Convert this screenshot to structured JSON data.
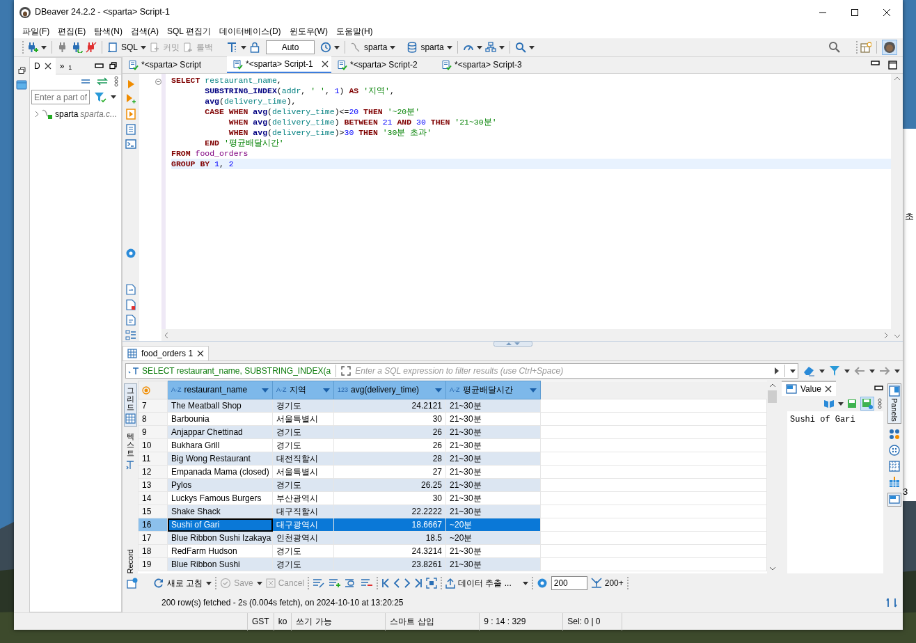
{
  "window": {
    "title": "DBeaver 24.2.2 - <sparta> Script-1"
  },
  "menu": [
    "파일(F)",
    "편집(E)",
    "탐색(N)",
    "검색(A)",
    "SQL 편집기",
    "데이터베이스(D)",
    "윈도우(W)",
    "도움말(H)"
  ],
  "toolbar": {
    "sql": "SQL",
    "commit": {
      "label": "커밋",
      "disabled": true
    },
    "rollback": {
      "label": "롤백",
      "disabled": true
    },
    "transaction_mode": "Auto",
    "datasource": "sparta",
    "schema": "sparta"
  },
  "navigator": {
    "tabs": [
      {
        "label": "D",
        "selected": true
      },
      {
        "label": "»$_{1}$",
        "selected": false
      }
    ],
    "filter": {
      "placeholder": "Enter a part of"
    },
    "tree": [
      {
        "label": "sparta",
        "detail": "sparta.c...",
        "expanded": false
      }
    ]
  },
  "editor_tabs": [
    {
      "label": "*<sparta> Script",
      "selected": false
    },
    {
      "label": "*<sparta> Script-1",
      "selected": true
    },
    {
      "label": "*<sparta> Script-2",
      "selected": false
    },
    {
      "label": "*<sparta> Script-3",
      "selected": false
    }
  ],
  "code": [
    {
      "current": false,
      "tokens": [
        {
          "text": "SELECT ",
          "kind": "keyword"
        },
        {
          "text": "restaurant_name",
          "kind": "column"
        },
        {
          "text": ",",
          "kind": "plain"
        }
      ]
    },
    {
      "current": false,
      "tokens": [
        {
          "text": "       SUBSTRING_INDEX",
          "kind": "function"
        },
        {
          "text": "(",
          "kind": "plain"
        },
        {
          "text": "addr",
          "kind": "column"
        },
        {
          "text": ", ",
          "kind": "plain"
        },
        {
          "text": "' '",
          "kind": "string"
        },
        {
          "text": ", ",
          "kind": "plain"
        },
        {
          "text": "1",
          "kind": "number"
        },
        {
          "text": ") ",
          "kind": "plain"
        },
        {
          "text": "AS ",
          "kind": "keyword"
        },
        {
          "text": "'지역'",
          "kind": "string"
        },
        {
          "text": ",",
          "kind": "plain"
        }
      ]
    },
    {
      "current": false,
      "tokens": [
        {
          "text": "       avg",
          "kind": "function"
        },
        {
          "text": "(",
          "kind": "plain"
        },
        {
          "text": "delivery_time",
          "kind": "column"
        },
        {
          "text": "),",
          "kind": "plain"
        }
      ]
    },
    {
      "current": false,
      "tokens": [
        {
          "text": "       CASE WHEN ",
          "kind": "keyword"
        },
        {
          "text": "avg",
          "kind": "function"
        },
        {
          "text": "(",
          "kind": "plain"
        },
        {
          "text": "delivery_time",
          "kind": "column"
        },
        {
          "text": ")<=",
          "kind": "plain"
        },
        {
          "text": "20",
          "kind": "number"
        },
        {
          "text": " THEN ",
          "kind": "keyword"
        },
        {
          "text": "'~20분'",
          "kind": "string"
        }
      ]
    },
    {
      "current": false,
      "tokens": [
        {
          "text": "            WHEN ",
          "kind": "keyword"
        },
        {
          "text": "avg",
          "kind": "function"
        },
        {
          "text": "(",
          "kind": "plain"
        },
        {
          "text": "delivery_time",
          "kind": "column"
        },
        {
          "text": ") ",
          "kind": "plain"
        },
        {
          "text": "BETWEEN ",
          "kind": "keyword"
        },
        {
          "text": "21",
          "kind": "number"
        },
        {
          "text": " AND ",
          "kind": "keyword"
        },
        {
          "text": "30",
          "kind": "number"
        },
        {
          "text": " THEN ",
          "kind": "keyword"
        },
        {
          "text": "'21~30분'",
          "kind": "string"
        }
      ]
    },
    {
      "current": false,
      "tokens": [
        {
          "text": "            WHEN ",
          "kind": "keyword"
        },
        {
          "text": "avg",
          "kind": "function"
        },
        {
          "text": "(",
          "kind": "plain"
        },
        {
          "text": "delivery_time",
          "kind": "column"
        },
        {
          "text": ")>",
          "kind": "plain"
        },
        {
          "text": "30",
          "kind": "number"
        },
        {
          "text": " THEN ",
          "kind": "keyword"
        },
        {
          "text": "'30분 초과'",
          "kind": "string"
        }
      ]
    },
    {
      "current": false,
      "tokens": [
        {
          "text": "       END ",
          "kind": "keyword"
        },
        {
          "text": "'평균배달시간'",
          "kind": "string"
        }
      ]
    },
    {
      "current": false,
      "tokens": [
        {
          "text": "FROM ",
          "kind": "keyword"
        },
        {
          "text": "food_orders",
          "kind": "table"
        }
      ]
    },
    {
      "current": true,
      "tokens": [
        {
          "text": "GROUP BY ",
          "kind": "keyword"
        },
        {
          "text": "1",
          "kind": "number"
        },
        {
          "text": ", ",
          "kind": "plain"
        },
        {
          "text": "2",
          "kind": "number"
        }
      ]
    }
  ],
  "results": {
    "tab": "food_orders 1",
    "query": "SELECT restaurant_name, SUBSTRING_INDEX(a",
    "filter": {
      "placeholder": "Enter a SQL expression to filter results (use Ctrl+Space)"
    },
    "views": [
      {
        "label": "그리드",
        "selected": true
      },
      {
        "label": "텍스트",
        "selected": false
      }
    ],
    "record": "Record",
    "columns": [
      {
        "type_label": "A-Z",
        "label": "restaurant_name",
        "kind": "text"
      },
      {
        "type_label": "A-Z",
        "label": "지역",
        "kind": "text"
      },
      {
        "type_label": "123",
        "label": "avg(delivery_time)",
        "kind": "number"
      },
      {
        "type_label": "A-Z",
        "label": "평균배달시간",
        "kind": "text"
      }
    ],
    "rows": [
      {
        "number": "7",
        "cells": [
          "The Meatball Shop",
          "경기도",
          "24.2121",
          "21~30분"
        ],
        "selected": false
      },
      {
        "number": "8",
        "cells": [
          "Barbounia",
          "서울특별시",
          "30",
          "21~30분"
        ],
        "selected": false
      },
      {
        "number": "9",
        "cells": [
          "Anjappar Chettinad",
          "경기도",
          "26",
          "21~30분"
        ],
        "selected": false
      },
      {
        "number": "10",
        "cells": [
          "Bukhara Grill",
          "경기도",
          "26",
          "21~30분"
        ],
        "selected": false
      },
      {
        "number": "11",
        "cells": [
          "Big Wong Restaurant",
          "대전직할시",
          "28",
          "21~30분"
        ],
        "selected": false
      },
      {
        "number": "12",
        "cells": [
          "Empanada Mama (closed)",
          "서울특별시",
          "27",
          "21~30분"
        ],
        "selected": false
      },
      {
        "number": "13",
        "cells": [
          "Pylos",
          "경기도",
          "26.25",
          "21~30분"
        ],
        "selected": false
      },
      {
        "number": "14",
        "cells": [
          "Luckys Famous Burgers",
          "부산광역시",
          "30",
          "21~30분"
        ],
        "selected": false
      },
      {
        "number": "15",
        "cells": [
          "Shake Shack",
          "대구직할시",
          "22.2222",
          "21~30분"
        ],
        "selected": false
      },
      {
        "number": "16",
        "cells": [
          "Sushi of Gari",
          "대구광역시",
          "18.6667",
          "~20분"
        ],
        "selected": true
      },
      {
        "number": "17",
        "cells": [
          "Blue Ribbon Sushi Izakaya",
          "인천광역시",
          "18.5",
          "~20분"
        ],
        "selected": false
      },
      {
        "number": "18",
        "cells": [
          "RedFarm Hudson",
          "경기도",
          "24.3214",
          "21~30분"
        ],
        "selected": false
      },
      {
        "number": "19",
        "cells": [
          "Blue Ribbon Sushi",
          "경기도",
          "23.8261",
          "21~30분"
        ],
        "selected": false
      }
    ],
    "value_panel": {
      "tab": "Value",
      "value": "Sushi of Gari"
    },
    "panels_tab": "Panels",
    "bottom_toolbar": {
      "refresh": "새로 고침",
      "save": {
        "label": "Save",
        "disabled": true
      },
      "cancel": {
        "label": "Cancel",
        "disabled": true
      },
      "export": "데이터 추출 ...",
      "fetch_size": "200",
      "fetch_all": "200+"
    },
    "message": "200 row(s) fetched - 2s (0.004s fetch), on 2024-10-10 at 13:20:25"
  },
  "status_bar": [
    "GST",
    "ko",
    "쓰기 가능",
    "스마트 삽입",
    "9 : 14 : 329",
    "Sel: 0 | 0"
  ],
  "background_texts": [
    "초",
    "3"
  ]
}
